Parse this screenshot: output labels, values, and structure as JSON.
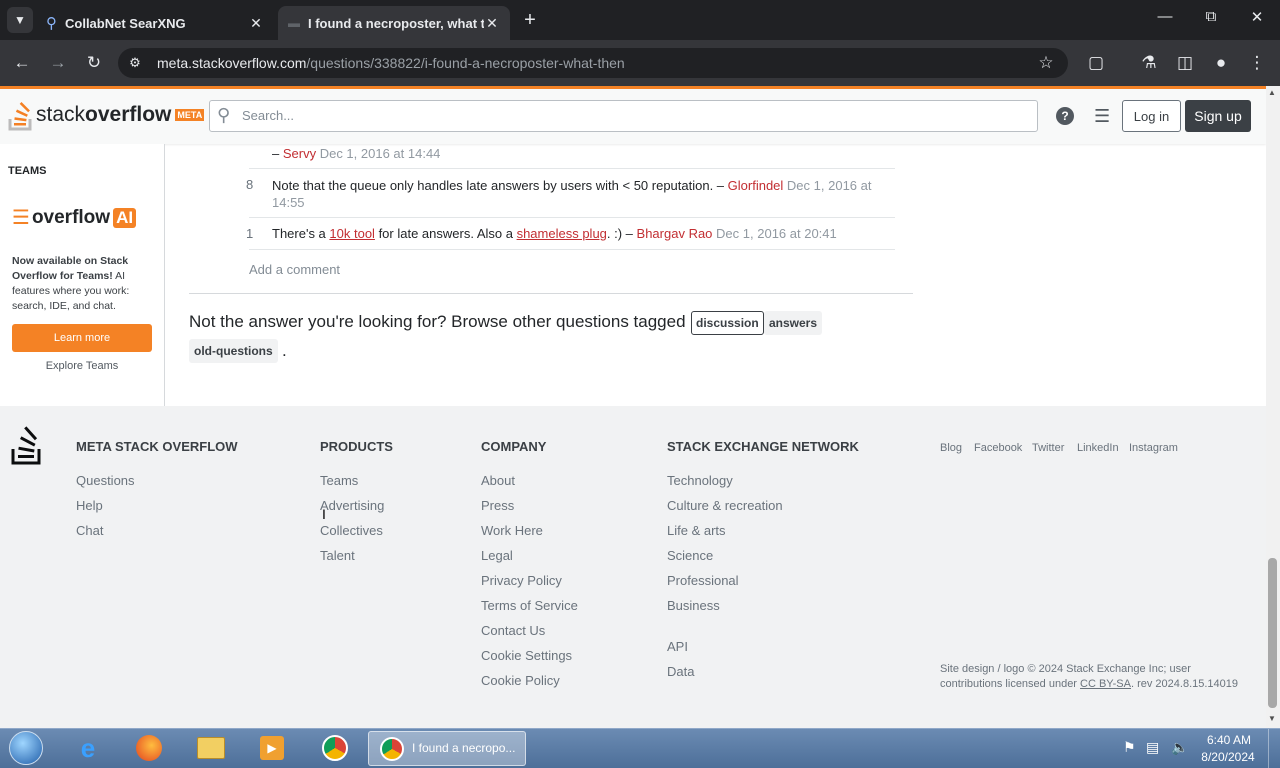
{
  "browser": {
    "tabs": [
      {
        "title": "CollabNet SearXNG"
      },
      {
        "title": "I found a necroposter, what th"
      }
    ],
    "url_host": "meta.stackoverflow.com",
    "url_path": "/questions/338822/i-found-a-necroposter-what-then"
  },
  "header": {
    "logo_word1": "stack",
    "logo_word2": "overflow",
    "logo_badge": "META",
    "search_placeholder": "Search...",
    "login_label": "Log in",
    "signup_label": "Sign up"
  },
  "sidebar": {
    "teams_heading": "TEAMS",
    "overflow_word": "overflow",
    "ai_badge": "AI",
    "promo_bold": "Now available on Stack Overflow for Teams!",
    "promo_rest": " AI features where you work: search, IDE, and chat.",
    "learn_more": "Learn more",
    "explore_teams": "Explore Teams"
  },
  "comments": [
    {
      "score": "",
      "prefix": "– ",
      "text": "",
      "user": "Servy",
      "date": "Dec 1, 2016 at 14:44"
    },
    {
      "score": "8",
      "text": "Note that the queue only handles late answers by users with < 50 reputation. – ",
      "user": "Glorfindel",
      "date": "Dec 1, 2016 at",
      "date2": "14:55"
    },
    {
      "score": "1",
      "text_a": "There's a ",
      "link1": "10k tool",
      "text_b": " for late answers. Also a ",
      "link2": "shameless plug",
      "text_c": ". :) – ",
      "user": "Bhargav Rao",
      "date": "Dec 1, 2016 at 20:41"
    }
  ],
  "add_comment": "Add a comment",
  "not_answer": {
    "text": "Not the answer you're looking for? Browse other questions tagged",
    "tags": [
      "discussion",
      "answers",
      "old-questions"
    ],
    "period": "."
  },
  "footer": {
    "col1": {
      "heading": "META STACK OVERFLOW",
      "links": [
        "Questions",
        "Help",
        "Chat"
      ]
    },
    "col2": {
      "heading": "PRODUCTS",
      "links": [
        "Teams",
        "Advertising",
        "Collectives",
        "Talent"
      ]
    },
    "col3": {
      "heading": "COMPANY",
      "links": [
        "About",
        "Press",
        "Work Here",
        "Legal",
        "Privacy Policy",
        "Terms of Service",
        "Contact Us",
        "Cookie Settings",
        "Cookie Policy"
      ]
    },
    "col4": {
      "heading": "STACK EXCHANGE NETWORK",
      "links": [
        "Technology",
        "Culture & recreation",
        "Life & arts",
        "Science",
        "Professional",
        "Business",
        "API",
        "Data"
      ]
    },
    "social": [
      "Blog",
      "Facebook",
      "Twitter",
      "LinkedIn",
      "Instagram"
    ],
    "legal_a": "Site design / logo © 2024 Stack Exchange Inc; user",
    "legal_b": "contributions licensed under ",
    "legal_link": "CC BY-SA",
    "legal_c": ". rev 2024.8.15.14019"
  },
  "taskbar": {
    "active_window": "I found a necropo...",
    "time": "6:40 AM",
    "date": "8/20/2024"
  }
}
